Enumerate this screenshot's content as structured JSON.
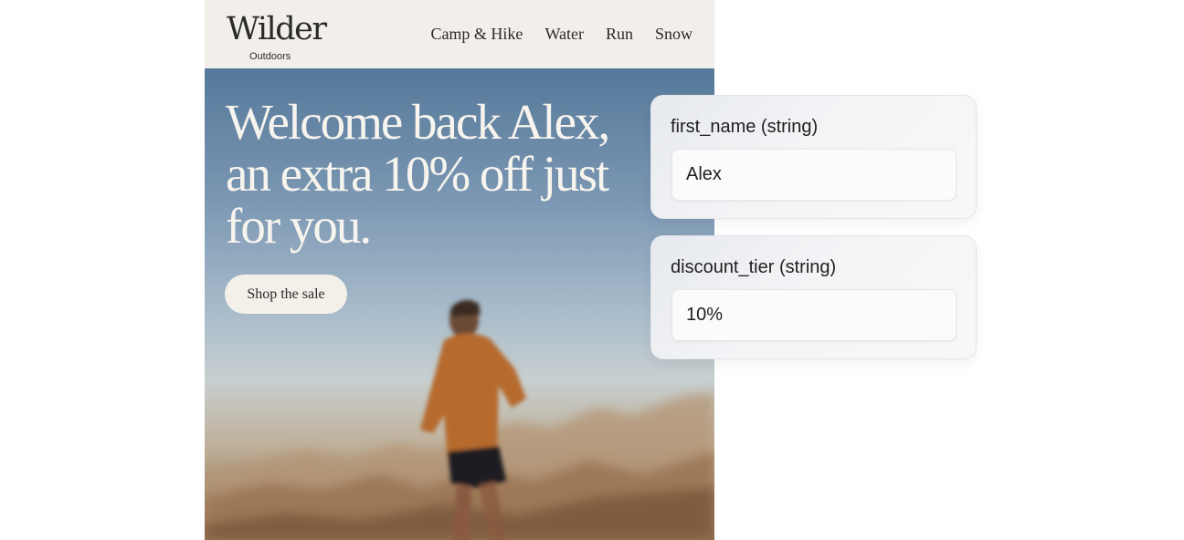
{
  "brand": {
    "name": "Wilder",
    "subtitle": "Outdoors"
  },
  "nav": {
    "items": [
      "Camp & Hike",
      "Water",
      "Run",
      "Snow"
    ]
  },
  "hero": {
    "headline": "Welcome back Alex, an extra 10% off just for you.",
    "cta_label": "Shop the sale"
  },
  "variables": [
    {
      "label": "first_name (string)",
      "value": "Alex"
    },
    {
      "label": "discount_tier (string)",
      "value": "10%"
    }
  ],
  "colors": {
    "header_bg": "#f2efea",
    "text_dark": "#2a2a2a",
    "headline_text": "#f7f4ee",
    "cta_bg": "#f3efe9"
  }
}
